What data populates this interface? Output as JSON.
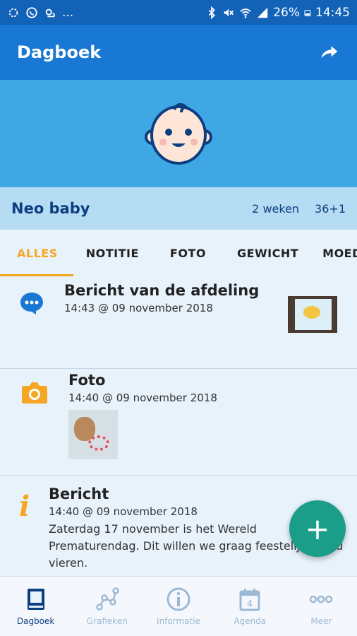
{
  "status_bar": {
    "left_icons": [
      "settings-icon",
      "whatsapp-icon",
      "weather-icon"
    ],
    "overflow": "...",
    "battery": "26%",
    "time": "14:45"
  },
  "app_bar": {
    "title": "Dagboek"
  },
  "profile": {
    "name": "Neo baby",
    "age": "2 weken",
    "gestation": "36+1"
  },
  "tabs": [
    {
      "label": "ALLES",
      "active": true
    },
    {
      "label": "NOTITIE"
    },
    {
      "label": "FOTO"
    },
    {
      "label": "GEWICHT"
    },
    {
      "label": "MOEDE"
    }
  ],
  "feed": [
    {
      "icon": "chat-bubble-icon",
      "title": "Bericht van de afdeling",
      "time": "14:43 @ 09 november 2018"
    },
    {
      "icon": "camera-icon",
      "title": "Foto",
      "time": "14:40 @ 09 november 2018"
    },
    {
      "icon": "info-icon",
      "title": "Bericht",
      "time": "14:40 @ 09 november 2018",
      "body": [
        "Zaterdag 17 november is het Wereld",
        "Prematurendag. Dit willen we graag feestelijk met u",
        "vieren."
      ]
    }
  ],
  "fab": {
    "label": "+"
  },
  "bottom_nav": [
    {
      "label": "Dagboek",
      "icon": "book-icon",
      "active": true
    },
    {
      "label": "Grafieken",
      "icon": "graph-icon"
    },
    {
      "label": "Informatie",
      "icon": "info-circle-icon"
    },
    {
      "label": "Agenda",
      "icon": "calendar-icon",
      "badge": "4"
    },
    {
      "label": "Meer",
      "icon": "more-icon"
    }
  ],
  "colors": {
    "primary": "#1978d3",
    "header": "#3fa8e4",
    "accent": "#f5a623",
    "fab": "#1a9e8a",
    "text_dark": "#0d3e80"
  }
}
